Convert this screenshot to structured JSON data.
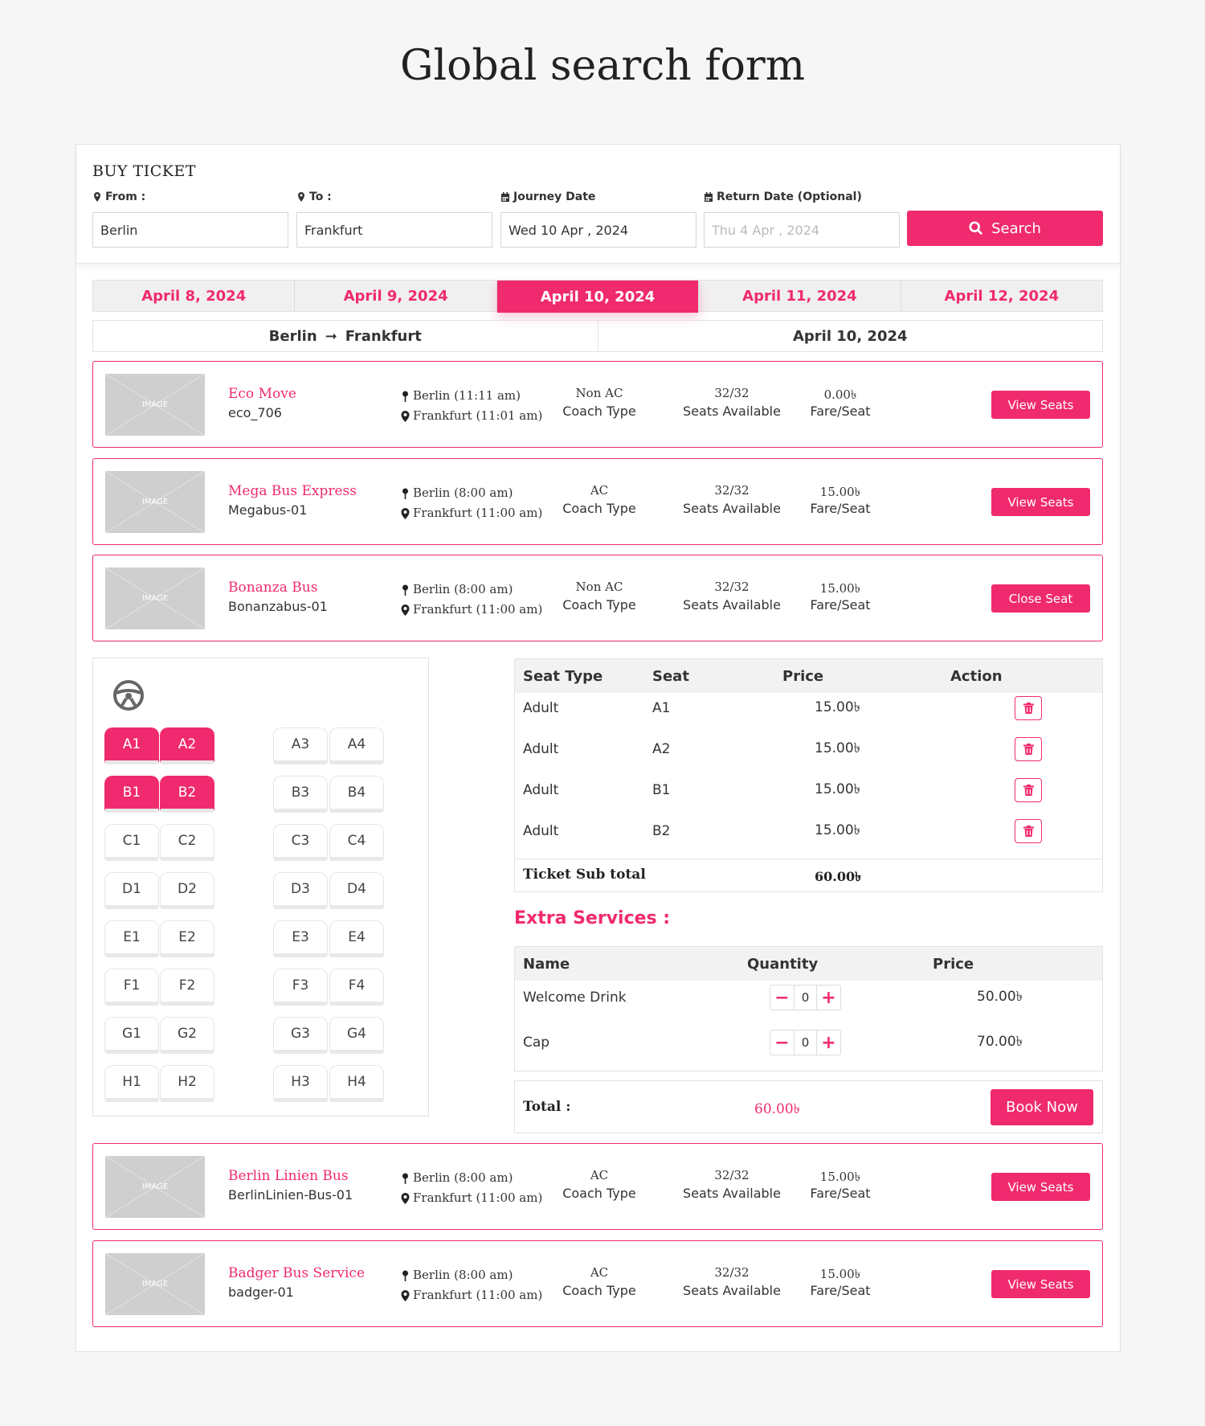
{
  "page_title": "Global search form",
  "search": {
    "heading": "BUY TICKET",
    "from_label": "From :",
    "from_value": "Berlin",
    "to_label": "To :",
    "to_value": "Frankfurt",
    "journey_label": "Journey Date",
    "journey_value": "Wed 10 Apr , 2024",
    "return_label": "Return Date (Optional)",
    "return_placeholder": "Thu 4 Apr , 2024",
    "search_label": "Search"
  },
  "date_tabs": [
    "April 8, 2024",
    "April 9, 2024",
    "April 10, 2024",
    "April 11, 2024",
    "April 12, 2024"
  ],
  "route": {
    "from": "Berlin",
    "arrow": "➞",
    "to": "Frankfurt",
    "date": "April 10, 2024"
  },
  "image_placeholder": "IMAGE",
  "labels": {
    "coach_type": "Coach Type",
    "seats_available": "Seats Available",
    "fare_seat": "Fare/Seat"
  },
  "buses": [
    {
      "name": "Eco Move",
      "code": "eco_706",
      "departure": "Berlin (11:11 am)",
      "arrival": "Frankfurt (11:01 am)",
      "coach": "Non AC",
      "seats": "32/32",
      "fare": "0.00৳",
      "button": "View Seats"
    },
    {
      "name": "Mega Bus Express",
      "code": "Megabus-01",
      "departure": "Berlin (8:00 am)",
      "arrival": "Frankfurt (11:00 am)",
      "coach": "AC",
      "seats": "32/32",
      "fare": "15.00৳",
      "button": "View Seats"
    },
    {
      "name": "Bonanza Bus",
      "code": "Bonanzabus-01",
      "departure": "Berlin (8:00 am)",
      "arrival": "Frankfurt (11:00 am)",
      "coach": "Non AC",
      "seats": "32/32",
      "fare": "15.00৳",
      "button": "Close Seat"
    },
    {
      "name": "Berlin Linien Bus",
      "code": "BerlinLinien-Bus-01",
      "departure": "Berlin (8:00 am)",
      "arrival": "Frankfurt (11:00 am)",
      "coach": "AC",
      "seats": "32/32",
      "fare": "15.00৳",
      "button": "View Seats"
    },
    {
      "name": "Badger Bus Service",
      "code": "badger-01",
      "departure": "Berlin (8:00 am)",
      "arrival": "Frankfurt (11:00 am)",
      "coach": "AC",
      "seats": "32/32",
      "fare": "15.00৳",
      "button": "View Seats"
    }
  ],
  "seat_rows": [
    {
      "row": [
        "A1",
        "A2",
        "A3",
        "A4"
      ],
      "selected": [
        true,
        true,
        false,
        false
      ]
    },
    {
      "row": [
        "B1",
        "B2",
        "B3",
        "B4"
      ],
      "selected": [
        true,
        true,
        false,
        false
      ]
    },
    {
      "row": [
        "C1",
        "C2",
        "C3",
        "C4"
      ],
      "selected": [
        false,
        false,
        false,
        false
      ]
    },
    {
      "row": [
        "D1",
        "D2",
        "D3",
        "D4"
      ],
      "selected": [
        false,
        false,
        false,
        false
      ]
    },
    {
      "row": [
        "E1",
        "E2",
        "E3",
        "E4"
      ],
      "selected": [
        false,
        false,
        false,
        false
      ]
    },
    {
      "row": [
        "F1",
        "F2",
        "F3",
        "F4"
      ],
      "selected": [
        false,
        false,
        false,
        false
      ]
    },
    {
      "row": [
        "G1",
        "G2",
        "G3",
        "G4"
      ],
      "selected": [
        false,
        false,
        false,
        false
      ]
    },
    {
      "row": [
        "H1",
        "H2",
        "H3",
        "H4"
      ],
      "selected": [
        false,
        false,
        false,
        false
      ]
    }
  ],
  "selected_table": {
    "headers": [
      "Seat Type",
      "Seat",
      "Price",
      "Action"
    ],
    "rows": [
      {
        "type": "Adult",
        "seat": "A1",
        "price": "15.00৳"
      },
      {
        "type": "Adult",
        "seat": "A2",
        "price": "15.00৳"
      },
      {
        "type": "Adult",
        "seat": "B1",
        "price": "15.00৳"
      },
      {
        "type": "Adult",
        "seat": "B2",
        "price": "15.00৳"
      }
    ],
    "subtotal_label": "Ticket Sub total",
    "subtotal_value": "60.00৳"
  },
  "extra_services": {
    "title": "Extra Services :",
    "headers": [
      "Name",
      "Quantity",
      "Price"
    ],
    "rows": [
      {
        "name": "Welcome Drink",
        "qty": "0",
        "price": "50.00৳"
      },
      {
        "name": "Cap",
        "qty": "0",
        "price": "70.00৳"
      }
    ]
  },
  "total": {
    "label": "Total :",
    "value": "60.00৳",
    "button": "Book Now"
  },
  "colors": {
    "accent": "#f02a6e",
    "header_bg": "#f2f2f2"
  }
}
